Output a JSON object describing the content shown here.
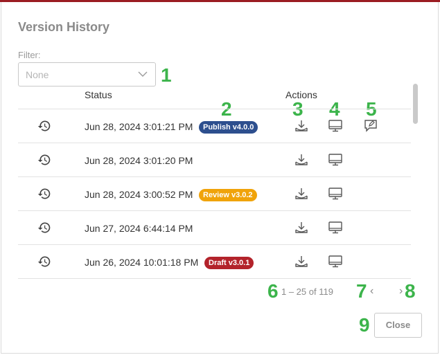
{
  "dialog": {
    "title": "Version History",
    "filter": {
      "label": "Filter:",
      "value": "None"
    },
    "columns": {
      "status": "Status",
      "actions": "Actions"
    },
    "rows": [
      {
        "timestamp": "Jun 28, 2024 3:01:21 PM",
        "badge": "Publish v4.0.0",
        "badge_color": "#2d4f8e",
        "has_edit": true
      },
      {
        "timestamp": "Jun 28, 2024 3:01:20 PM",
        "badge": "",
        "has_edit": false
      },
      {
        "timestamp": "Jun 28, 2024 3:00:52 PM",
        "badge": "Review v3.0.2",
        "badge_color": "#f0a30a",
        "has_edit": false
      },
      {
        "timestamp": "Jun 27, 2024 6:44:14 PM",
        "badge": "",
        "has_edit": false
      },
      {
        "timestamp": "Jun 26, 2024 10:01:18 PM",
        "badge": "Draft v3.0.1",
        "badge_color": "#b3232b",
        "has_edit": false
      }
    ],
    "pagination": {
      "range": "1 – 25 of 119",
      "prev_icon": "chevron-left-icon",
      "next_icon": "chevron-right-icon"
    },
    "close_label": "Close"
  },
  "annotations": [
    "1",
    "2",
    "3",
    "4",
    "5",
    "6",
    "7",
    "8",
    "9"
  ],
  "colors": {
    "accent_bar": "#9b1c22",
    "annotation": "#3cb44b"
  }
}
